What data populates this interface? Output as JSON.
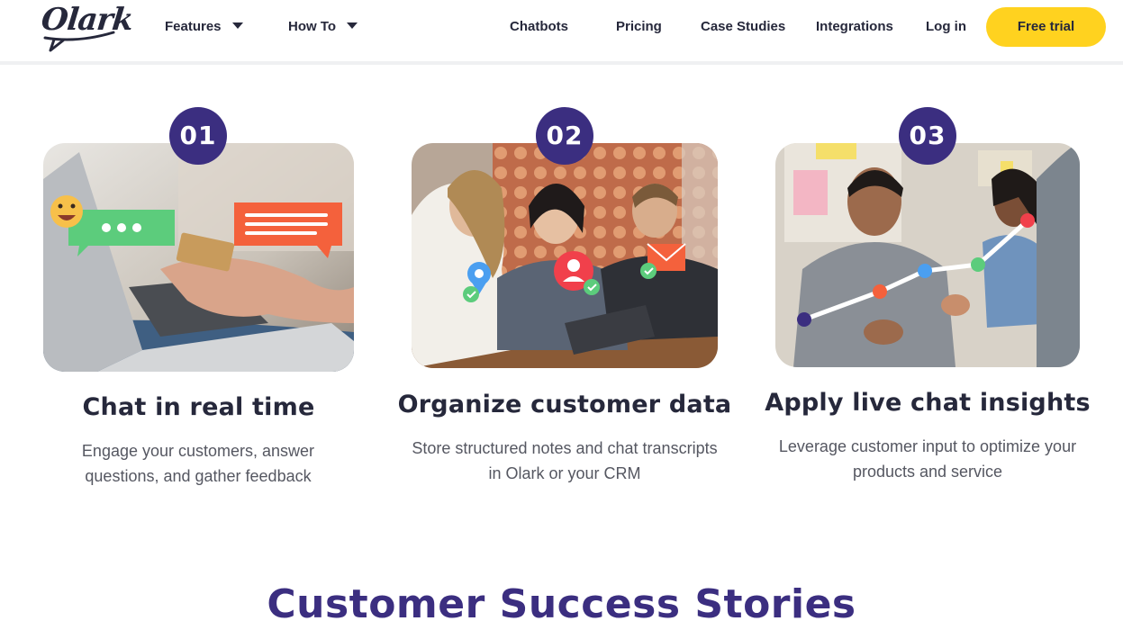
{
  "header": {
    "logo_text": "Olark",
    "nav": {
      "features": "Features",
      "how_to": "How To",
      "chatbots": "Chatbots",
      "pricing": "Pricing",
      "case_studies": "Case Studies",
      "integrations": "Integrations",
      "log_in": "Log in"
    },
    "cta_label": "Free trial"
  },
  "features": [
    {
      "step": "01",
      "title": "Chat in real time",
      "description": "Engage your customers, answer questions, and gather feedback",
      "image_subject": "person holding a credit card in front of a laptop with chat bubbles"
    },
    {
      "step": "02",
      "title": "Organize customer data",
      "description": "Store structured notes and chat transcripts in Olark or your CRM",
      "image_subject": "three coworkers at a laptop with contact and location pins"
    },
    {
      "step": "03",
      "title": "Apply live chat insights",
      "description": "Leverage customer input to optimize your products and service",
      "image_subject": "team meeting with a rising line chart overlay"
    }
  ],
  "section_heading": "Customer Success Stories",
  "colors": {
    "brand_purple": "#3b2e80",
    "cta_yellow": "#ffd21f",
    "text_dark": "#26283b",
    "text_muted": "#555761"
  }
}
